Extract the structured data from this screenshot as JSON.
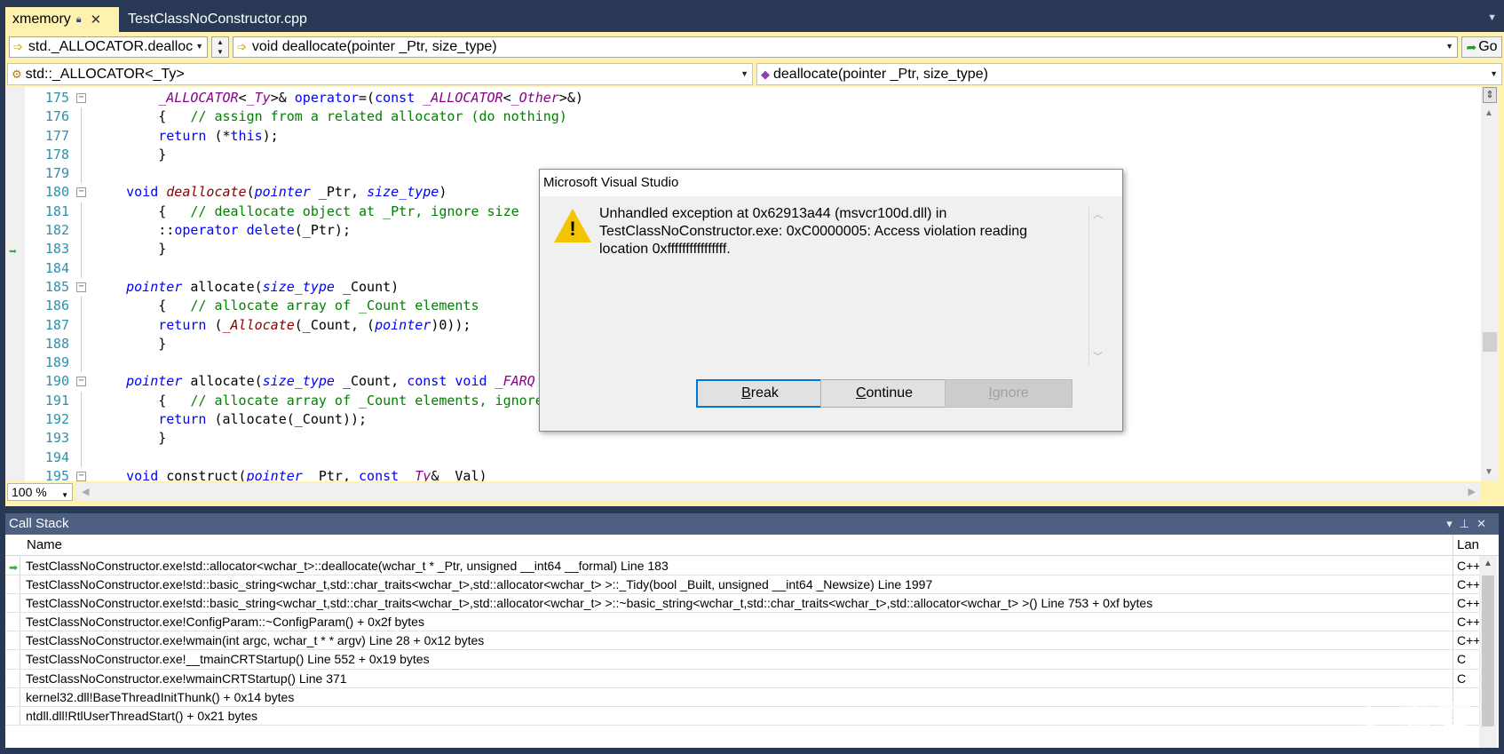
{
  "tabs": [
    {
      "label": "xmemory",
      "active": true
    },
    {
      "label": "TestClassNoConstructor.cpp",
      "active": false
    }
  ],
  "debug_toolbar": {
    "stack_frame_combo": "std._ALLOCATOR.dealloc",
    "function_combo": "void deallocate(pointer _Ptr, size_type)",
    "go_label": "Go"
  },
  "nav_bar": {
    "scope_combo": "std::_ALLOCATOR<_Ty>",
    "member_combo": "deallocate(pointer _Ptr, size_type)"
  },
  "editor": {
    "zoom": "100 %",
    "current_line": 183,
    "lines": [
      {
        "n": "175",
        "fold": true,
        "html": "        <span class=\"mac\">_ALLOCATOR</span>&lt;<span class=\"mac\">_Ty</span>&gt;&amp; <span class=\"kw\">operator</span>=(<span class=\"kw\">const</span> <span class=\"mac\">_ALLOCATOR</span>&lt;<span class=\"mac\">_Other</span>&gt;&amp;)"
      },
      {
        "n": "176",
        "fold": false,
        "html": "        {   <span class=\"cm\">// assign from a related allocator (do nothing)</span>"
      },
      {
        "n": "177",
        "fold": false,
        "html": "        <span class=\"kw\">return</span> (*<span class=\"kw\">this</span>);"
      },
      {
        "n": "178",
        "fold": false,
        "html": "        }"
      },
      {
        "n": "179",
        "fold": false,
        "html": ""
      },
      {
        "n": "180",
        "fold": true,
        "html": "    <span class=\"kw\">void</span> <span class=\"fn\">deallocate</span>(<span class=\"ty\">pointer</span> _Ptr, <span class=\"ty\">size_type</span>)"
      },
      {
        "n": "181",
        "fold": false,
        "html": "        {   <span class=\"cm\">// deallocate object at _Ptr, ignore size</span>"
      },
      {
        "n": "182",
        "fold": false,
        "html": "        ::<span class=\"kw\">operator</span> <span class=\"kw\">delete</span>(_Ptr);"
      },
      {
        "n": "183",
        "fold": false,
        "html": "        }"
      },
      {
        "n": "184",
        "fold": false,
        "html": ""
      },
      {
        "n": "185",
        "fold": true,
        "html": "    <span class=\"ty\">pointer</span> allocate(<span class=\"ty\">size_type</span> _Count)"
      },
      {
        "n": "186",
        "fold": false,
        "html": "        {   <span class=\"cm\">// allocate array of _Count elements</span>"
      },
      {
        "n": "187",
        "fold": false,
        "html": "        <span class=\"kw\">return</span> (<span class=\"fn\">_Allocate</span>(_Count, (<span class=\"ty\">pointer</span>)0));"
      },
      {
        "n": "188",
        "fold": false,
        "html": "        }"
      },
      {
        "n": "189",
        "fold": false,
        "html": ""
      },
      {
        "n": "190",
        "fold": true,
        "html": "    <span class=\"ty\">pointer</span> allocate(<span class=\"ty\">size_type</span> _Count, <span class=\"kw\">const</span> <span class=\"kw\">void</span> <span class=\"mac\">_FARQ</span> *"
      },
      {
        "n": "191",
        "fold": false,
        "html": "        {   <span class=\"cm\">// allocate array of _Count elements, ignore</span>"
      },
      {
        "n": "192",
        "fold": false,
        "html": "        <span class=\"kw\">return</span> (allocate(_Count));"
      },
      {
        "n": "193",
        "fold": false,
        "html": "        }"
      },
      {
        "n": "194",
        "fold": false,
        "html": ""
      },
      {
        "n": "195",
        "fold": true,
        "html": "    <span class=\"kw\">void</span> construct(<span class=\"ty\">pointer</span> _Ptr, <span class=\"kw\">const</span> <span class=\"mac\">_Ty</span>&amp; _Val)"
      }
    ]
  },
  "dialog": {
    "title": "Microsoft Visual Studio",
    "message": "Unhandled exception at 0x62913a44 (msvcr100d.dll) in TestClassNoConstructor.exe: 0xC0000005: Access violation reading location 0xffffffffffffffff.",
    "buttons": {
      "break": "Break",
      "continue": "Continue",
      "ignore": "Ignore"
    }
  },
  "callstack": {
    "title": "Call Stack",
    "col_name": "Name",
    "col_lang": "Lan",
    "rows": [
      {
        "name": "TestClassNoConstructor.exe!std::allocator<wchar_t>::deallocate(wchar_t * _Ptr, unsigned __int64 __formal)  Line 183",
        "lang": "C++"
      },
      {
        "name": "TestClassNoConstructor.exe!std::basic_string<wchar_t,std::char_traits<wchar_t>,std::allocator<wchar_t> >::_Tidy(bool _Built, unsigned __int64 _Newsize)  Line 1997",
        "lang": "C++"
      },
      {
        "name": "TestClassNoConstructor.exe!std::basic_string<wchar_t,std::char_traits<wchar_t>,std::allocator<wchar_t> >::~basic_string<wchar_t,std::char_traits<wchar_t>,std::allocator<wchar_t> >()  Line 753 + 0xf bytes",
        "lang": "C++"
      },
      {
        "name": "TestClassNoConstructor.exe!ConfigParam::~ConfigParam()  + 0x2f bytes",
        "lang": "C++"
      },
      {
        "name": "TestClassNoConstructor.exe!wmain(int argc, wchar_t * * argv)  Line 28 + 0x12 bytes",
        "lang": "C++"
      },
      {
        "name": "TestClassNoConstructor.exe!__tmainCRTStartup()  Line 552 + 0x19 bytes",
        "lang": "C"
      },
      {
        "name": "TestClassNoConstructor.exe!wmainCRTStartup()  Line 371",
        "lang": "C"
      },
      {
        "name": "kernel32.dll!BaseThreadInitThunk()  + 0x14 bytes",
        "lang": ""
      },
      {
        "name": "ntdll.dll!RtlUserThreadStart()  + 0x21 bytes",
        "lang": ""
      }
    ]
  },
  "watermark": "❄ 看雪",
  "colors": {
    "ide_background": "#293955",
    "active_tab": "#fff1b0",
    "current_statement_arrow": "#3fa83f",
    "keyword": "#0000ff",
    "comment": "#008000",
    "line_number": "#2b91af",
    "warning_icon": "#f5c400",
    "default_button_border": "#0078d7"
  }
}
